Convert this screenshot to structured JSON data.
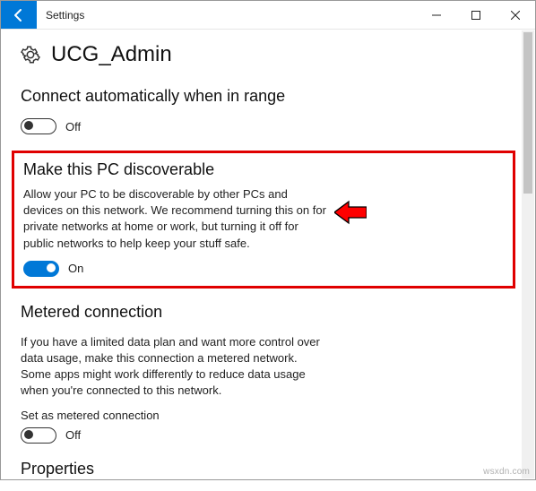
{
  "window": {
    "title": "Settings"
  },
  "page": {
    "title": "UCG_Admin"
  },
  "sections": {
    "connect": {
      "title": "Connect automatically when in range",
      "toggle_state": "Off"
    },
    "discoverable": {
      "title": "Make this PC discoverable",
      "description": "Allow your PC to be discoverable by other PCs and devices on this network. We recommend turning this on for private networks at home or work, but turning it off for public networks to help keep your stuff safe.",
      "toggle_state": "On"
    },
    "metered": {
      "title": "Metered connection",
      "description": "If you have a limited data plan and want more control over data usage, make this connection a metered network. Some apps might work differently to reduce data usage when you're connected to this network.",
      "label": "Set as metered connection",
      "toggle_state": "Off"
    },
    "properties": {
      "title": "Properties"
    }
  },
  "watermark": "wsxdn.com"
}
